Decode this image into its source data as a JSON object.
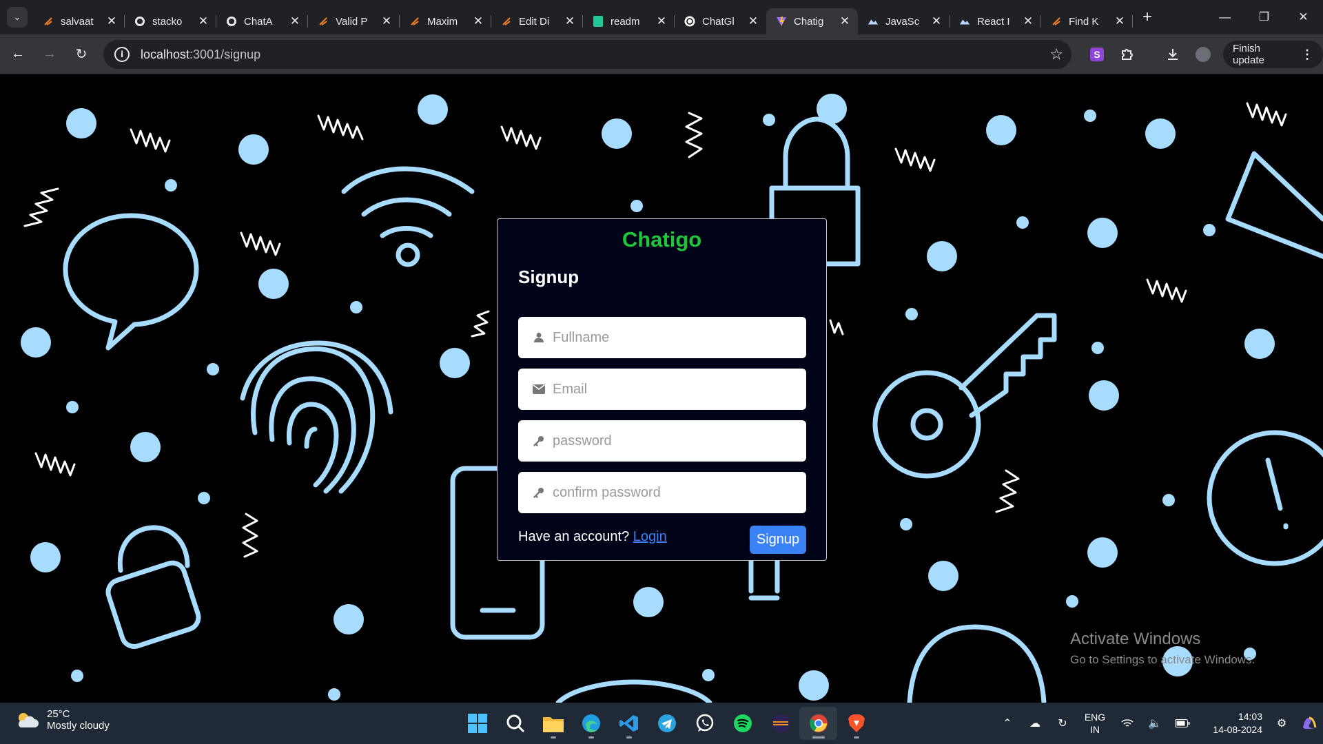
{
  "browser": {
    "tabs": [
      {
        "title": "salvaat",
        "icon": "slash-icon",
        "active": false
      },
      {
        "title": "stacko",
        "icon": "github-icon",
        "active": false
      },
      {
        "title": "ChatA",
        "icon": "github-icon",
        "active": false
      },
      {
        "title": "Valid P",
        "icon": "slash-icon",
        "active": false
      },
      {
        "title": "Maxim",
        "icon": "slash-icon",
        "active": false
      },
      {
        "title": "Edit Di",
        "icon": "slash-icon",
        "active": false
      },
      {
        "title": "readm",
        "icon": "sheet-icon",
        "active": false
      },
      {
        "title": "ChatGl",
        "icon": "openai-icon",
        "active": false
      },
      {
        "title": "Chatig",
        "icon": "vite-icon",
        "active": true
      },
      {
        "title": "JavaSc",
        "icon": "cloud-icon",
        "active": false
      },
      {
        "title": "React I",
        "icon": "cloud-icon",
        "active": false
      },
      {
        "title": "Find K",
        "icon": "slash-icon",
        "active": false
      }
    ],
    "url_host": "localhost",
    "url_path": ":3001/signup",
    "finish_update": "Finish update",
    "extension_letter": "S"
  },
  "form": {
    "brand": "Chatigo",
    "heading": "Signup",
    "fullname_placeholder": "Fullname",
    "email_placeholder": "Email",
    "password_placeholder": "password",
    "confirm_placeholder": "confirm password",
    "have_account": "Have an account?",
    "login_link": "Login",
    "signup_button": "Signup"
  },
  "watermark": {
    "line1": "Activate Windows",
    "line2": "Go to Settings to activate Windows."
  },
  "taskbar": {
    "temperature": "25°C",
    "weather": "Mostly cloudy",
    "lang1": "ENG",
    "lang2": "IN",
    "time": "14:03",
    "date": "14-08-2024",
    "apps": [
      "windows-start-icon",
      "search-icon",
      "file-explorer-icon",
      "edge-icon",
      "vscode-icon",
      "telegram-icon",
      "whatsapp-icon",
      "spotify-icon",
      "eclipse-icon",
      "chrome-icon",
      "brave-icon"
    ]
  },
  "colors": {
    "brand": "#1fc63c",
    "button": "#3b82f6",
    "card_bg": "#010418",
    "doodle": "#a8dcff"
  }
}
